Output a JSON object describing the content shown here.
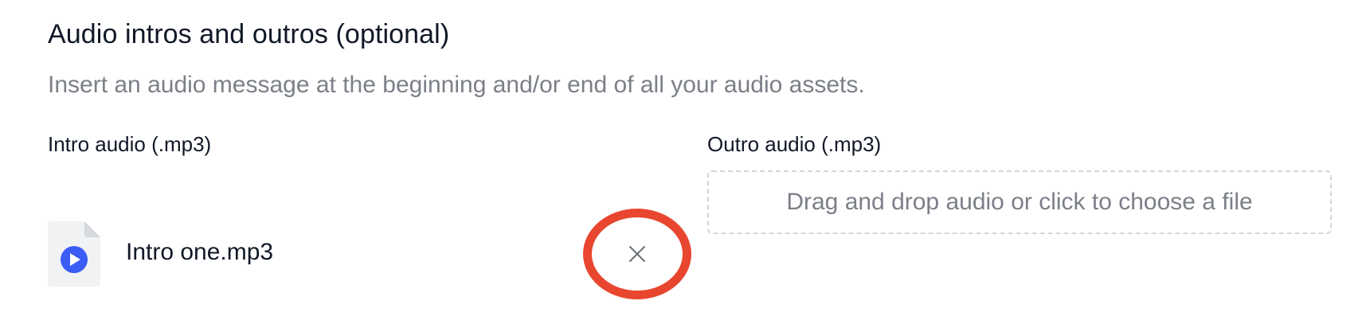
{
  "section": {
    "title": "Audio intros and outros (optional)",
    "description": "Insert an audio message at the beginning and/or end of all your audio assets."
  },
  "intro": {
    "label": "Intro audio (.mp3)",
    "file": {
      "name": "Intro one.mp3",
      "icon": "audio-file-play-icon"
    },
    "remove_icon": "close-icon"
  },
  "outro": {
    "label": "Outro audio (.mp3)",
    "dropzone_text": "Drag and drop audio or click to choose a file"
  },
  "colors": {
    "highlight_ring": "#e8462f",
    "play_accent": "#3b5cf5",
    "muted_text": "#7b7f87"
  }
}
